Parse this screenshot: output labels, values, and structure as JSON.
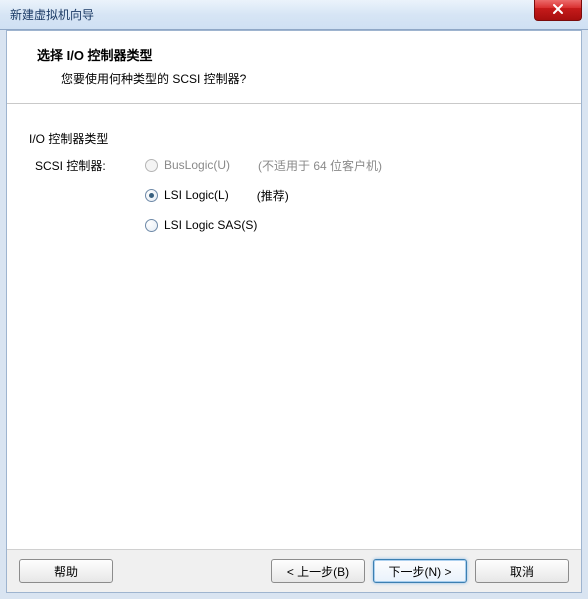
{
  "window": {
    "title": "新建虚拟机向导"
  },
  "header": {
    "title": "选择 I/O 控制器类型",
    "subtitle": "您要使用何种类型的 SCSI 控制器?"
  },
  "section": {
    "label": "I/O 控制器类型",
    "scsi_label": "SCSI 控制器:"
  },
  "options": {
    "buslogic": {
      "label": "BusLogic(U)",
      "note": "(不适用于 64 位客户机)",
      "enabled": false,
      "selected": false
    },
    "lsilogic": {
      "label": "LSI Logic(L)",
      "note": "(推荐)",
      "enabled": true,
      "selected": true
    },
    "lsisas": {
      "label": "LSI Logic SAS(S)",
      "note": "",
      "enabled": true,
      "selected": false
    }
  },
  "footer": {
    "help": "帮助",
    "back": "< 上一步(B)",
    "next": "下一步(N) >",
    "cancel": "取消"
  }
}
